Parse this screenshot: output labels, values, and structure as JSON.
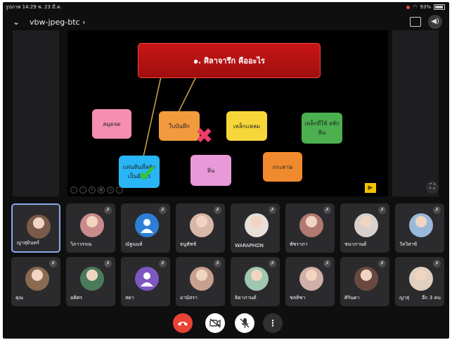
{
  "status_bar": {
    "left": "รูปภาพ  14:29  พ. 23 มี.ค.",
    "battery": "93%"
  },
  "meeting": {
    "title": "vbw-jpeg-btc",
    "title_suffix": "›"
  },
  "slide": {
    "title": "๑. ศิลาจารึก คืออะไร",
    "cards": [
      {
        "label": "สมุดจด",
        "color": "#f48fb1"
      },
      {
        "label": "ใบบันทึก",
        "color": "#f29a3e"
      },
      {
        "label": "เหล็กแหลม",
        "color": "#f7d63a"
      },
      {
        "label": "เหล็กที่ใช้ สลักหิน",
        "color": "#4caf50"
      },
      {
        "label": "แท่นหินที่สลัก เป็นอักษร",
        "color": "#29b6f6"
      },
      {
        "label": "หิน",
        "color": "#e89ad8"
      },
      {
        "label": "กระดาษ",
        "color": "#f08a2e"
      }
    ]
  },
  "participants": [
    {
      "name": "ญาสุมินทร์",
      "avatar": "photo",
      "color": "#7a5a4a",
      "active": true
    },
    {
      "name": "วิภาวรรณ",
      "avatar": "photo",
      "color": "#c98b8b"
    },
    {
      "name": "ณัฐนนท์",
      "avatar": "person",
      "color": "#2d7fd6"
    },
    {
      "name": "ธนูพัชช์",
      "avatar": "photo",
      "color": "#d8b8a8"
    },
    {
      "name": "WARAPHON",
      "avatar": "photo",
      "color": "#e8e0d8"
    },
    {
      "name": "พัชราภา",
      "avatar": "photo",
      "color": "#b07a70"
    },
    {
      "name": "ชนาภานต์",
      "avatar": "photo",
      "color": "#d8d0cc"
    },
    {
      "name": "วัลวิสาข์",
      "avatar": "photo",
      "color": "#9ab8d8"
    },
    {
      "name": "คุณ",
      "avatar": "photo",
      "color": "#8a6a50"
    },
    {
      "name": "อติศร",
      "avatar": "photo",
      "color": "#4a7a5a"
    },
    {
      "name": "สดา",
      "avatar": "person",
      "color": "#7e57c2"
    },
    {
      "name": "อานัสรา",
      "avatar": "photo",
      "color": "#c8a090"
    },
    {
      "name": "ธิดาภานต์",
      "avatar": "photo",
      "color": "#a0c8b0"
    },
    {
      "name": "ชลทิชา",
      "avatar": "photo",
      "color": "#d0b0a8"
    },
    {
      "name": "ศิรินดา",
      "avatar": "photo",
      "color": "#6a4a40"
    },
    {
      "name": "ญาสุ",
      "extra": "อีก 3 คน",
      "avatar": "photo",
      "color": "#e0d0c0"
    }
  ],
  "controls": {
    "end_call_color": "#ea4335"
  }
}
